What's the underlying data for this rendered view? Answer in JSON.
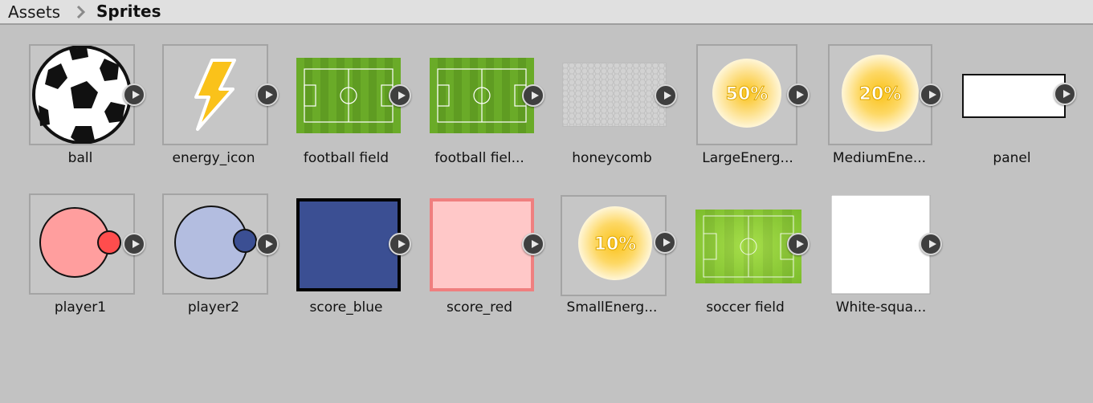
{
  "breadcrumb": {
    "root": "Assets",
    "current": "Sprites"
  },
  "assets": [
    {
      "label": "ball"
    },
    {
      "label": "energy_icon"
    },
    {
      "label": "football field"
    },
    {
      "label": "football fiel..."
    },
    {
      "label": "honeycomb"
    },
    {
      "label": "LargeEnerg...",
      "badge_text": "50%"
    },
    {
      "label": "MediumEne...",
      "badge_text": "20%"
    },
    {
      "label": "panel"
    },
    {
      "label": "player1"
    },
    {
      "label": "player2"
    },
    {
      "label": "score_blue"
    },
    {
      "label": "score_red"
    },
    {
      "label": "SmallEnerg...",
      "badge_text": "10%"
    },
    {
      "label": "soccer field"
    },
    {
      "label": "White-squa..."
    }
  ],
  "icons": {
    "breadcrumb_separator": "chevron-right-icon",
    "expand": "play-icon"
  },
  "colors": {
    "background": "#c2c2c2",
    "field_green": "#6aab28",
    "score_blue": "#3b4f93",
    "score_red": "#ffc8c8",
    "player1": "#ff9e9e",
    "player2": "#b3bde0",
    "energy_yellow": "#fac21a"
  }
}
